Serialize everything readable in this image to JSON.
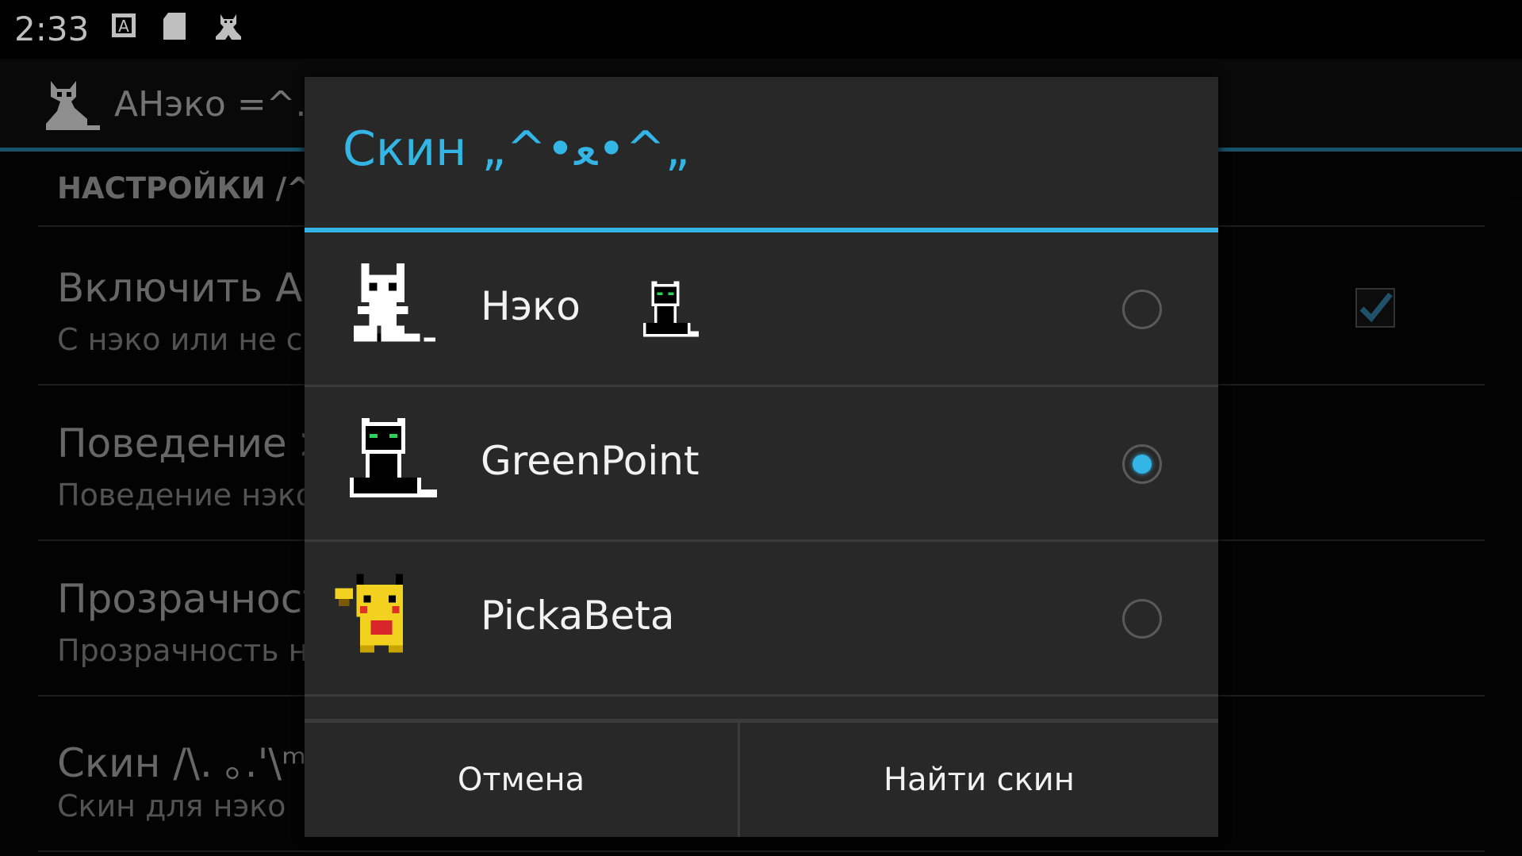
{
  "status_bar": {
    "time": "2:33",
    "icons": [
      "font-a-icon",
      "sd-card-icon",
      "neko-icon"
    ]
  },
  "action_bar": {
    "title": "АНэко =^.^"
  },
  "background": {
    "category": "НАСТРОЙКИ /^",
    "preferences": [
      {
        "title": "Включить АН",
        "summary": "С нэко или не с"
      },
      {
        "title": "Поведение ≫",
        "summary": "Поведение нэко"
      },
      {
        "title": "Прозрачност",
        "summary": "Прозрачность н"
      },
      {
        "title": "Скин /\\. ｡.'\\ᵐ",
        "summary": "Скин для нэко"
      }
    ],
    "enable_checked": true
  },
  "dialog": {
    "title": "Скин „^•ﻌ•^„",
    "options": [
      {
        "label": "Нэко",
        "selected": false
      },
      {
        "label": "GreenPoint",
        "selected": true
      },
      {
        "label": "PickaBeta",
        "selected": false
      }
    ],
    "buttons": {
      "cancel": "Отмена",
      "find": "Найти скин"
    }
  },
  "colors": {
    "accent": "#33b5e5",
    "dialog_bg": "#282828"
  }
}
